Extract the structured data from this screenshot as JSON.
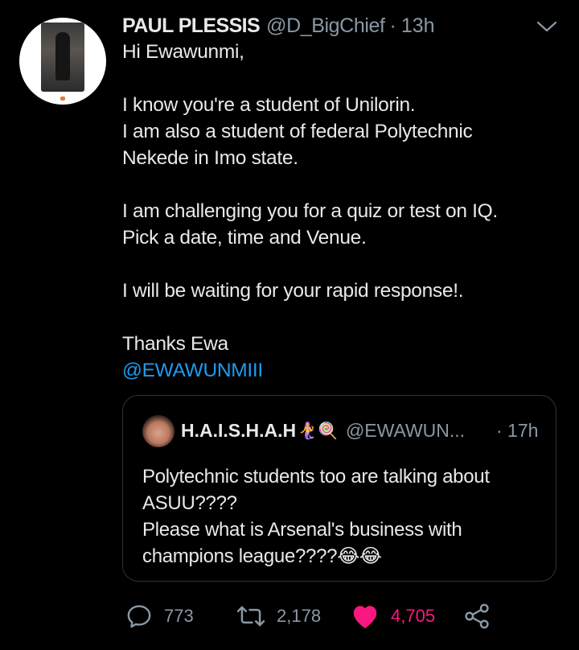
{
  "tweet": {
    "author_name": "PAUL PLESSIS",
    "author_handle": "@D_BigChief",
    "separator": "·",
    "time": "13h",
    "lines": [
      "Hi Ewawunmi,",
      "",
      "I know you're a student of Unilorin.",
      "I am also a student of federal Polytechnic",
      "Nekede in Imo state.",
      "",
      "I am challenging you for a quiz or test on IQ.",
      "Pick a date, time and Venue.",
      "",
      "I will be waiting for your rapid response!.",
      "",
      "Thanks Ewa"
    ],
    "mention": "@EWAWUNMIII",
    "icons": {
      "menu": "chevron-down-icon",
      "avatar": "profile-photo"
    }
  },
  "quoted_tweet": {
    "author_name": "H.A.I.S.H.A.H",
    "emojis": "🧜‍♀️🍭",
    "author_handle": "@EWAWUN...",
    "time": "· 17h",
    "lines": [
      "Polytechnic students too are talking about",
      "ASUU????",
      "Please what is Arsenal's business with",
      "champions league????😂😂"
    ]
  },
  "actions": {
    "reply": {
      "icon": "reply-icon",
      "count": "773"
    },
    "retweet": {
      "icon": "retweet-icon",
      "count": "2,178"
    },
    "like": {
      "icon": "heart-icon",
      "count": "4,705",
      "liked": true
    },
    "share": {
      "icon": "share-icon"
    }
  },
  "colors": {
    "background": "#000000",
    "text": "#e7e9ea",
    "secondary": "#8b98a5",
    "link": "#1d9bf0",
    "like": "#f91880",
    "border": "#2f3336"
  }
}
